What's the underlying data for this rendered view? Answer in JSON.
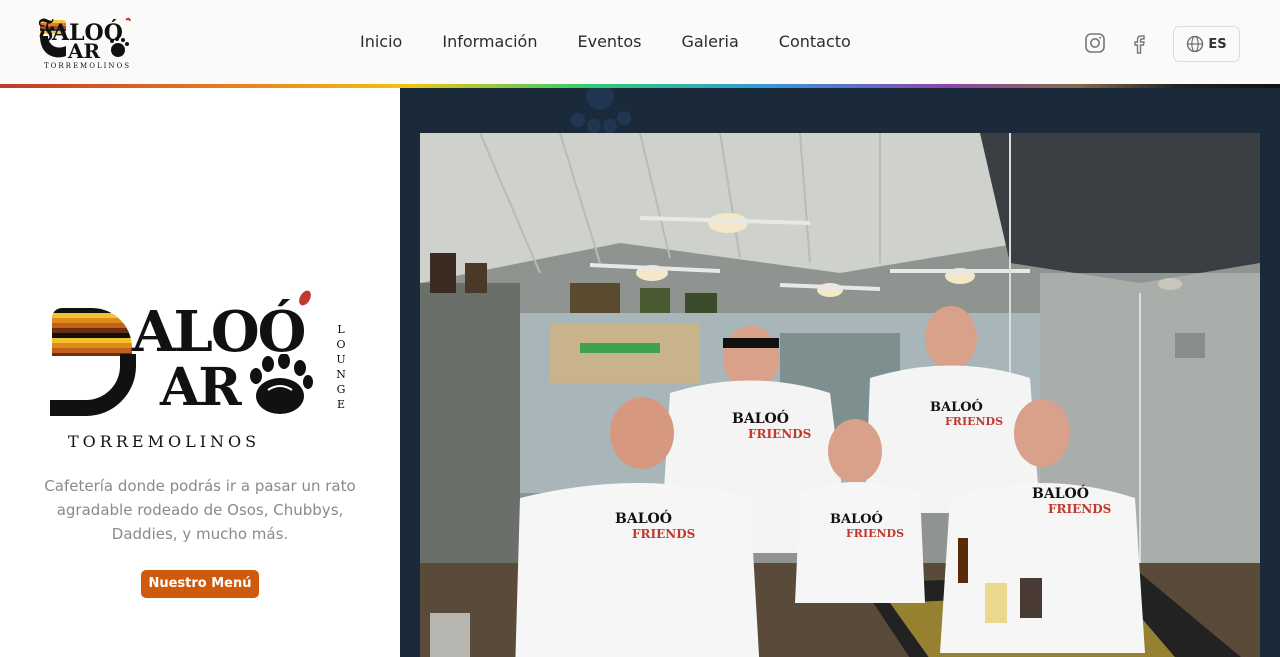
{
  "header": {
    "logo": {
      "name": "BALOÓ BAR",
      "subtitle": "TORREMOLINOS"
    },
    "nav": [
      {
        "label": "Inicio"
      },
      {
        "label": "Información"
      },
      {
        "label": "Eventos"
      },
      {
        "label": "Galeria"
      },
      {
        "label": "Contacto"
      }
    ],
    "social": [
      {
        "icon": "instagram-icon"
      },
      {
        "icon": "facebook-icon"
      }
    ],
    "language": {
      "icon": "globe-icon",
      "label": "ES"
    }
  },
  "hero": {
    "logo": {
      "line1": "ALOÓ",
      "line2": "AR",
      "vertical": "LOUNGE",
      "town": "TORREMOLINOS"
    },
    "tagline": "Cafetería donde podrás ir a pasar un rato agradable rodeado de Osos, Chubbys, Daddies, y mucho más.",
    "menu_button": "Nuestro Menú",
    "photo": {
      "shirt_text_1": "BALOÓ",
      "shirt_text_2": "FRIENDS"
    }
  },
  "colors": {
    "accent": "#cf5a0c",
    "panel": "#1b2a3a",
    "header_bg": "#fbfaf8"
  }
}
